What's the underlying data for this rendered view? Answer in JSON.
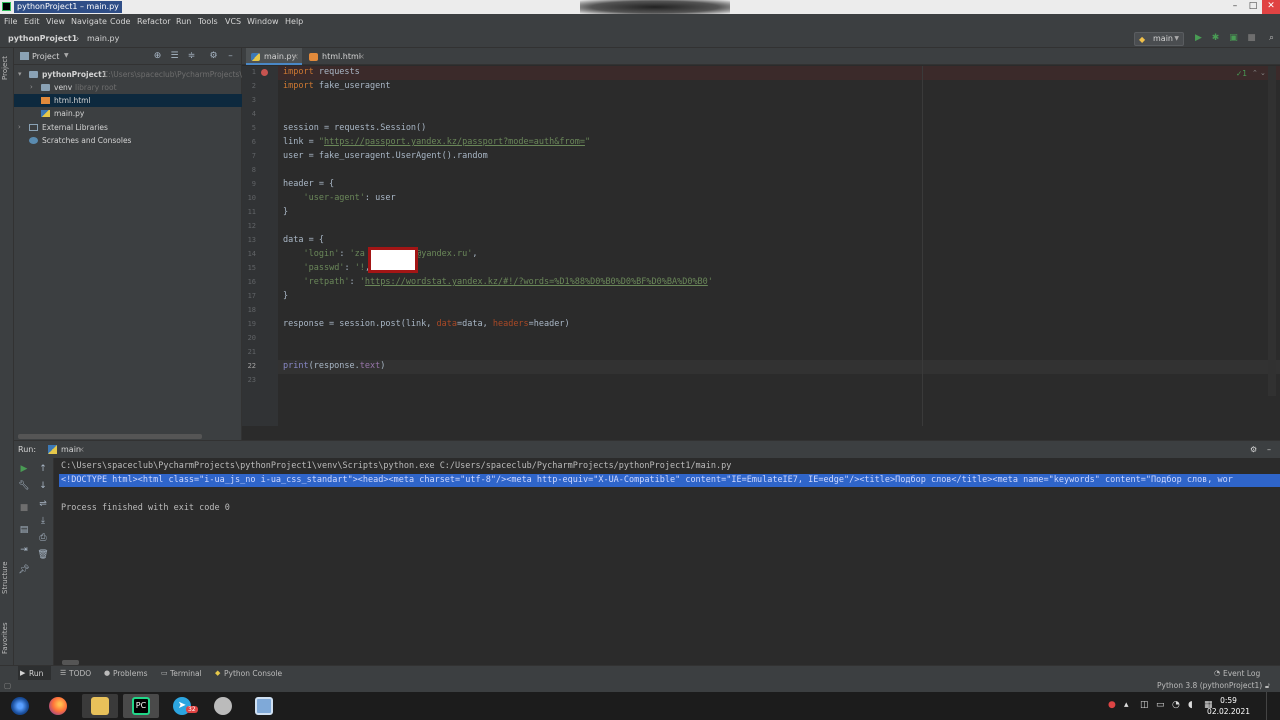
{
  "window": {
    "title": "pythonProject1 – main.py",
    "controls": [
      "–",
      "□",
      "✕"
    ]
  },
  "menu": [
    "File",
    "Edit",
    "View",
    "Navigate",
    "Code",
    "Refactor",
    "Run",
    "Tools",
    "VCS",
    "Window",
    "Help"
  ],
  "breadcrumbs": [
    "pythonProject1",
    "main.py"
  ],
  "run_config": "main",
  "toolbar_icons": [
    "run-icon",
    "debug-icon",
    "coverage-icon",
    "stop-icon",
    "search-icon"
  ],
  "project_panel": {
    "title": "Project",
    "tree": [
      {
        "label": "pythonProject1",
        "hint": "C:\\Users\\spaceclub\\PycharmProjects\\p",
        "type": "folder",
        "indent": 0,
        "expanded": true
      },
      {
        "label": "venv",
        "hint": "library root",
        "type": "folder",
        "indent": 1,
        "expanded": false
      },
      {
        "label": "html.html",
        "hint": "",
        "type": "html",
        "indent": 1,
        "selected": true
      },
      {
        "label": "main.py",
        "hint": "",
        "type": "py",
        "indent": 1
      },
      {
        "label": "External Libraries",
        "hint": "",
        "type": "lib",
        "indent": 0,
        "expanded": false
      },
      {
        "label": "Scratches and Consoles",
        "hint": "",
        "type": "scratch",
        "indent": 0
      }
    ]
  },
  "left_stripe": {
    "project": "Project",
    "structure": "Structure",
    "favorites": "Favorites"
  },
  "editor_tabs": [
    {
      "label": "main.py",
      "active": true
    },
    {
      "label": "html.html",
      "active": false
    }
  ],
  "editor": {
    "inspection": "1",
    "line_numbers": [
      "1",
      "2",
      "3",
      "4",
      "5",
      "6",
      "7",
      "8",
      "9",
      "10",
      "11",
      "12",
      "13",
      "14",
      "15",
      "16",
      "17",
      "18",
      "19",
      "20",
      "21",
      "22",
      "23"
    ],
    "current_line": 22,
    "lines": [
      {
        "n": 1,
        "t": [
          {
            "k": "kw",
            "v": "import"
          },
          {
            "k": "",
            "v": " requests"
          }
        ]
      },
      {
        "n": 2,
        "t": [
          {
            "k": "kw",
            "v": "import"
          },
          {
            "k": "",
            "v": " fake_useragent"
          }
        ]
      },
      {
        "n": 5,
        "t": [
          {
            "k": "",
            "v": "session = requests.Session()"
          }
        ]
      },
      {
        "n": 6,
        "t": [
          {
            "k": "",
            "v": "link = "
          },
          {
            "k": "str",
            "v": "\""
          },
          {
            "k": "url",
            "v": "https://passport.yandex.kz/passport?mode=auth&from="
          },
          {
            "k": "str",
            "v": "\""
          }
        ]
      },
      {
        "n": 7,
        "t": [
          {
            "k": "",
            "v": "user = fake_useragent.UserAgent().random"
          }
        ]
      },
      {
        "n": 9,
        "t": [
          {
            "k": "",
            "v": "header = {"
          }
        ]
      },
      {
        "n": 10,
        "t": [
          {
            "k": "",
            "v": "    "
          },
          {
            "k": "str",
            "v": "'user-agent'"
          },
          {
            "k": "",
            "v": ": user"
          }
        ]
      },
      {
        "n": 11,
        "t": [
          {
            "k": "",
            "v": "}"
          }
        ]
      },
      {
        "n": 13,
        "t": [
          {
            "k": "",
            "v": "data = {"
          }
        ]
      },
      {
        "n": 14,
        "t": [
          {
            "k": "",
            "v": "    "
          },
          {
            "k": "str",
            "v": "'login'"
          },
          {
            "k": "",
            "v": ": "
          },
          {
            "k": "str",
            "v": "'za          @yandex.ru'"
          },
          {
            "k": "",
            "v": ","
          }
        ]
      },
      {
        "n": 15,
        "t": [
          {
            "k": "",
            "v": "    "
          },
          {
            "k": "str",
            "v": "'passwd'"
          },
          {
            "k": "",
            "v": ": "
          },
          {
            "k": "str",
            "v": "'!"
          },
          {
            "k": "",
            "v": ","
          }
        ]
      },
      {
        "n": 16,
        "t": [
          {
            "k": "",
            "v": "    "
          },
          {
            "k": "str",
            "v": "'retpath'"
          },
          {
            "k": "",
            "v": ": "
          },
          {
            "k": "str",
            "v": "'"
          },
          {
            "k": "url",
            "v": "https://wordstat.yandex.kz/#!/?words=%D1%88%D0%B0%D0%BF%D0%BA%D0%B0"
          },
          {
            "k": "str",
            "v": "'"
          }
        ]
      },
      {
        "n": 17,
        "t": [
          {
            "k": "",
            "v": "}"
          }
        ]
      },
      {
        "n": 19,
        "t": [
          {
            "k": "",
            "v": "response = session.post(link, "
          },
          {
            "k": "param",
            "v": "data"
          },
          {
            "k": "",
            "v": "=data, "
          },
          {
            "k": "param",
            "v": "headers"
          },
          {
            "k": "",
            "v": "=header)"
          }
        ]
      },
      {
        "n": 22,
        "t": [
          {
            "k": "func",
            "v": "print"
          },
          {
            "k": "",
            "v": "(response."
          },
          {
            "k": "attr",
            "v": "text"
          },
          {
            "k": "",
            "v": ")"
          }
        ]
      }
    ]
  },
  "run_panel": {
    "label": "Run:",
    "tab": "main",
    "output": [
      "C:\\Users\\spaceclub\\PycharmProjects\\pythonProject1\\venv\\Scripts\\python.exe C:/Users/spaceclub/PycharmProjects/pythonProject1/main.py",
      "<!DOCTYPE html><html class=\"i-ua_js_no i-ua_css_standart\"><head><meta charset=\"utf-8\"/><meta http-equiv=\"X-UA-Compatible\" content=\"IE=EmulateIE7, IE=edge\"/><title>Подбор слов</title><meta name=\"keywords\" content=\"Подбор слов, wor",
      "",
      "Process finished with exit code 0"
    ]
  },
  "bottom_tabs": [
    {
      "label": "Run",
      "active": true
    },
    {
      "label": "TODO",
      "active": false
    },
    {
      "label": "Problems",
      "active": false
    },
    {
      "label": "Terminal",
      "active": false
    },
    {
      "label": "Python Console",
      "active": false
    }
  ],
  "event_log": "Event Log",
  "status": {
    "interpreter": "Python 3.8 (pythonProject1)"
  },
  "taskbar": {
    "time": "0:59",
    "date": "02.02.2021",
    "apps": [
      "start-icon",
      "firefox-icon",
      "explorer-icon",
      "pycharm-icon",
      "telegram-icon",
      "app-icon",
      "window-icon"
    ],
    "badge": "32"
  },
  "colors": {
    "keyword": "#cc7832",
    "string": "#6a8759",
    "selection": "#2f65ca",
    "bg": "#2b2b2b"
  }
}
